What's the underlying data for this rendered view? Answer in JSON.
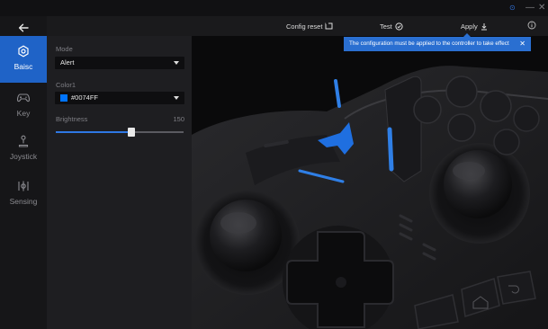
{
  "window": {
    "link_glyph": "⊙",
    "minimize_glyph": "—",
    "close_glyph": "✕"
  },
  "toolbar": {
    "config_reset_label": "Config reset",
    "test_label": "Test",
    "apply_label": "Apply"
  },
  "notification": {
    "message": "The configuration must be applied to the controller to take effect",
    "close_glyph": "✕"
  },
  "sidebar": {
    "items": [
      {
        "label": "Baisc",
        "icon": "gear-icon",
        "active": true
      },
      {
        "label": "Key",
        "icon": "gamepad-icon",
        "active": false
      },
      {
        "label": "Joystick",
        "icon": "joystick-icon",
        "active": false
      },
      {
        "label": "Sensing",
        "icon": "sensing-icon",
        "active": false
      }
    ]
  },
  "settings": {
    "mode": {
      "label": "Mode",
      "value": "Alert"
    },
    "color1": {
      "label": "Color1",
      "value": "#0074FF",
      "swatch": "#0074ff"
    },
    "brightness": {
      "label": "Brightness",
      "value": "150",
      "fraction": 0.59
    }
  },
  "colors": {
    "accent": "#1f63c7",
    "led_blue": "#0074ff",
    "toast": "#2a6fd1"
  }
}
